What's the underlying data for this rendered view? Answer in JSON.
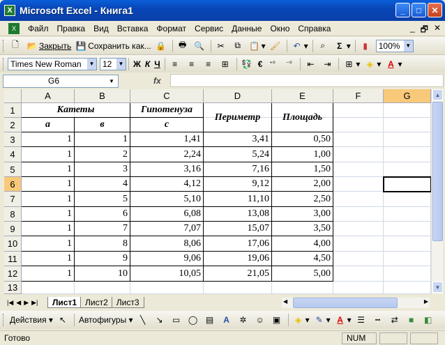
{
  "window": {
    "title": "Microsoft Excel - Книга1"
  },
  "menu": [
    "Файл",
    "Правка",
    "Вид",
    "Вставка",
    "Формат",
    "Сервис",
    "Данные",
    "Окно",
    "Справка"
  ],
  "toolbar1": {
    "close_label": "Закрыть",
    "save_as_label": "Сохранить как...",
    "zoom": "100%"
  },
  "toolbar2": {
    "font": "Times New Roman",
    "size": "12",
    "bold": "Ж",
    "italic": "К",
    "underline": "Ч",
    "currency": "€"
  },
  "formula": {
    "namebox": "G6",
    "fx": "fx",
    "value": ""
  },
  "columns": [
    "A",
    "B",
    "C",
    "D",
    "E",
    "F",
    "G"
  ],
  "rows": [
    "1",
    "2",
    "3",
    "4",
    "5",
    "6",
    "7",
    "8",
    "9",
    "10",
    "11",
    "12",
    "13"
  ],
  "headers": {
    "katety": "Катеты",
    "gipotenuza": "Гипотенуза",
    "perimetr": "Периметр",
    "ploshad": "Площадь",
    "a": "а",
    "b": "в",
    "c": "с"
  },
  "table": [
    [
      "1",
      "1",
      "1,41",
      "3,41",
      "0,50"
    ],
    [
      "1",
      "2",
      "2,24",
      "5,24",
      "1,00"
    ],
    [
      "1",
      "3",
      "3,16",
      "7,16",
      "1,50"
    ],
    [
      "1",
      "4",
      "4,12",
      "9,12",
      "2,00"
    ],
    [
      "1",
      "5",
      "5,10",
      "11,10",
      "2,50"
    ],
    [
      "1",
      "6",
      "6,08",
      "13,08",
      "3,00"
    ],
    [
      "1",
      "7",
      "7,07",
      "15,07",
      "3,50"
    ],
    [
      "1",
      "8",
      "8,06",
      "17,06",
      "4,00"
    ],
    [
      "1",
      "9",
      "9,06",
      "19,06",
      "4,50"
    ],
    [
      "1",
      "10",
      "10,05",
      "21,05",
      "5,00"
    ]
  ],
  "sheets": [
    "Лист1",
    "Лист2",
    "Лист3"
  ],
  "drawing": {
    "actions": "Действия",
    "autoshapes": "Автофигуры"
  },
  "status": {
    "text": "Готово",
    "num": "NUM"
  },
  "selected_cell": "G6"
}
